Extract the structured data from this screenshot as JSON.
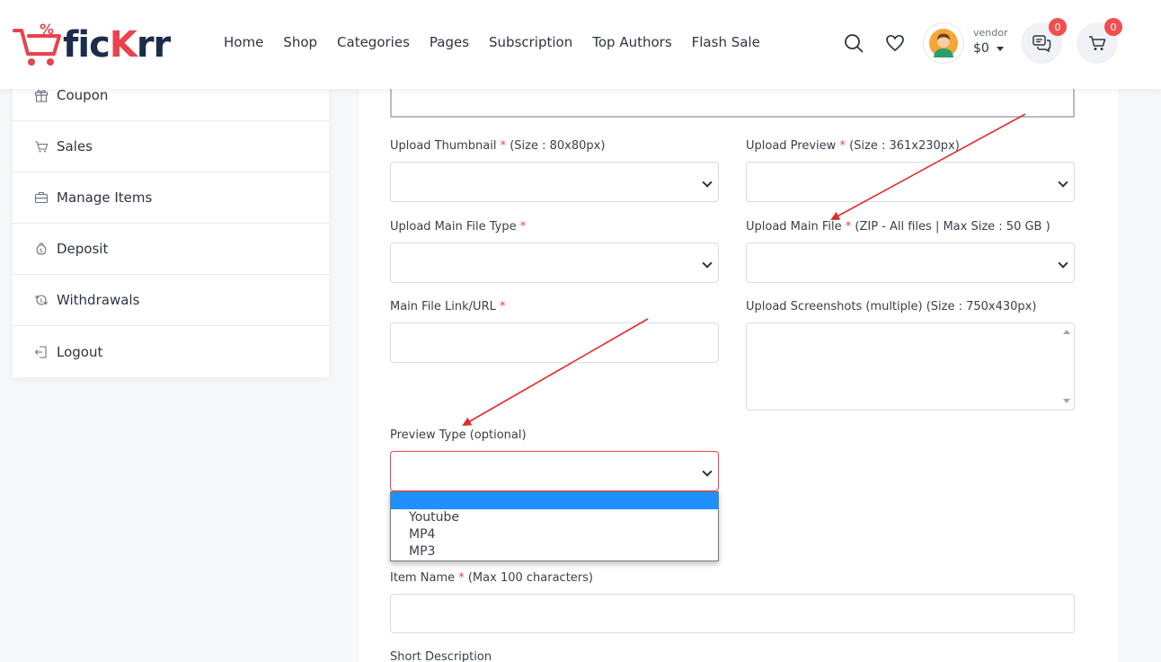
{
  "header": {
    "logo": {
      "text_a": "fic",
      "text_k": "K",
      "text_b": "rr"
    },
    "nav": [
      "Home",
      "Shop",
      "Categories",
      "Pages",
      "Subscription",
      "Top Authors",
      "Flash Sale"
    ],
    "account": {
      "role": "vendor",
      "balance": "$0"
    },
    "messages_count": "0",
    "cart_count": "0",
    "colors": {
      "brand_red": "#e8434f",
      "brand_navy": "#1c2c4c",
      "badge": "#f0504f"
    }
  },
  "sidebar": {
    "items": [
      {
        "label": "Coupon",
        "icon": "gift-icon"
      },
      {
        "label": "Sales",
        "icon": "cart-icon"
      },
      {
        "label": "Manage Items",
        "icon": "briefcase-icon"
      },
      {
        "label": "Deposit",
        "icon": "money-bag-icon"
      },
      {
        "label": "Withdrawals",
        "icon": "money-exchange-icon"
      },
      {
        "label": "Logout",
        "icon": "logout-icon"
      }
    ]
  },
  "form": {
    "thumbnail": {
      "label": "Upload Thumbnail",
      "req": "*",
      "hint": "(Size : 80x80px)"
    },
    "preview": {
      "label": "Upload Preview",
      "req": "*",
      "hint": "(Size : 361x230px)"
    },
    "main_file_type": {
      "label": "Upload Main File Type",
      "req": "*"
    },
    "main_file": {
      "label": "Upload Main File",
      "req": "*",
      "hint": "(ZIP - All files | Max Size : 50 GB )"
    },
    "main_file_link": {
      "label": "Main File Link/URL",
      "req": "*"
    },
    "screenshots": {
      "label": "Upload Screenshots (multiple) (Size : 750x430px)"
    },
    "preview_type": {
      "label": "Preview Type (optional)",
      "options": [
        "",
        "Youtube",
        "MP4",
        "MP3"
      ]
    },
    "item_name": {
      "label": "Item Name",
      "req": "*",
      "hint": "(Max 100 characters)"
    },
    "short_description": {
      "label": "Short Description"
    }
  }
}
